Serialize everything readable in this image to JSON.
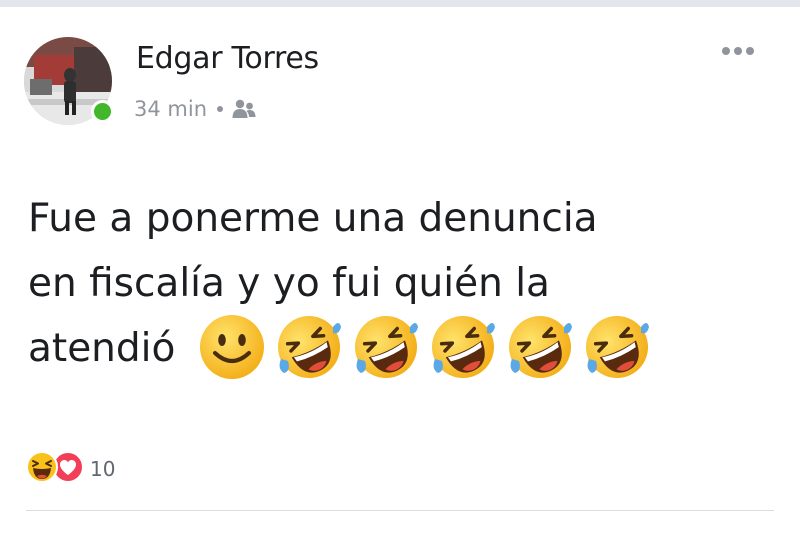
{
  "post": {
    "author": "Edgar Torres",
    "timestamp": "34 min",
    "audience_icon": "friends-icon",
    "avatar": "user-avatar-photo",
    "online_status": "online",
    "text_line1": "Fue a ponerme una denuncia",
    "text_line2": "en fiscalía y yo fui quién la",
    "text_line3": "atendió",
    "emojis": [
      "slightly-smiling-face",
      "rolling-on-floor-laughing",
      "rolling-on-floor-laughing",
      "rolling-on-floor-laughing",
      "rolling-on-floor-laughing",
      "rolling-on-floor-laughing"
    ]
  },
  "reactions": {
    "types": [
      "haha",
      "love"
    ],
    "count": "10"
  },
  "colors": {
    "online": "#42b72a",
    "secondary_text": "#90949c",
    "love": "#f33e58",
    "emoji_yellow": "#f8c21a"
  }
}
